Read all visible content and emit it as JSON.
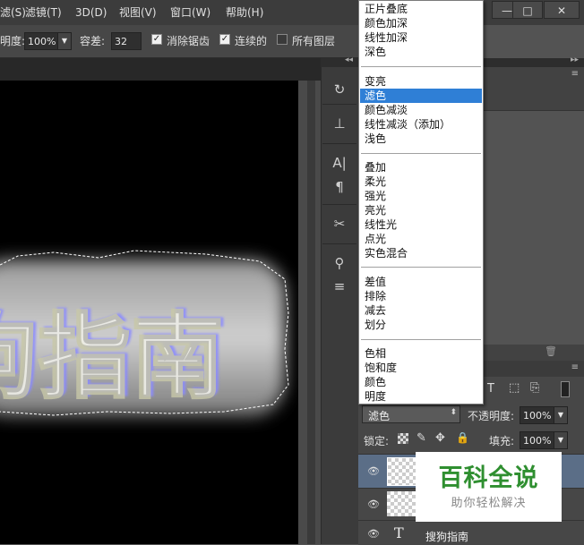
{
  "menubar": {
    "items": [
      "滤(S)",
      "滤镜(T)",
      "3D(D)",
      "视图(V)",
      "窗口(W)",
      "帮助(H)"
    ],
    "window_buttons": [
      "—",
      "□",
      "✕"
    ]
  },
  "options": {
    "opacity_label": "明度:",
    "opacity_value": "100%",
    "tolerance_label": "容差:",
    "tolerance_value": "32",
    "antialias_label": "消除锯齿",
    "antialias_checked": true,
    "contiguous_label": "连续的",
    "contiguous_checked": true,
    "all_layers_label": "所有图层",
    "all_layers_checked": false
  },
  "canvas": {
    "text": "狗指南",
    "glow_color": "#d8d8d8",
    "fill_color": "#ffffe0",
    "shadow_color": "#8a8aff"
  },
  "tools": {
    "icons": [
      "history-brush-icon",
      "clone-stamp-icon",
      "character-icon",
      "paragraph-icon",
      "tools-icon",
      "brush-presets-icon",
      "clone-source-icon"
    ]
  },
  "blend_menu": {
    "groups": [
      [
        "正片叠底",
        "颜色加深",
        "线性加深",
        "深色"
      ],
      [
        "变亮",
        "滤色",
        "颜色减淡",
        "线性减淡（添加）",
        "浅色"
      ],
      [
        "叠加",
        "柔光",
        "强光",
        "亮光",
        "线性光",
        "点光",
        "实色混合"
      ],
      [
        "差值",
        "排除",
        "减去",
        "划分"
      ],
      [
        "色相",
        "饱和度",
        "颜色",
        "明度"
      ]
    ],
    "selected": "滤色",
    "accent": "#2f7fd6"
  },
  "layers": {
    "blend_mode": "滤色",
    "opacity_label": "不透明度:",
    "opacity_value": "100%",
    "lock_label": "锁定:",
    "fill_label": "填充:",
    "fill_value": "100%",
    "rows": [
      {
        "name": ""
      },
      {
        "name": ""
      },
      {
        "name": "搜狗指南",
        "type_icon": "T"
      }
    ]
  },
  "watermark": {
    "title": "百科全说",
    "subtitle": "助你轻松解决"
  }
}
